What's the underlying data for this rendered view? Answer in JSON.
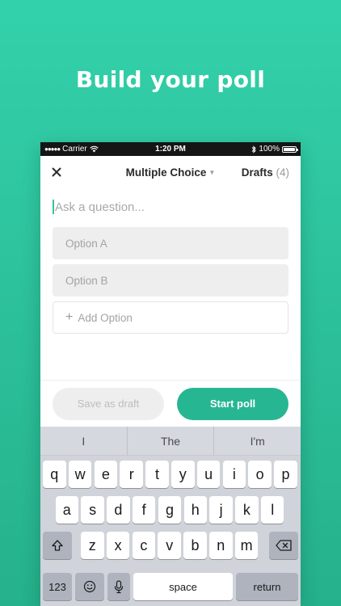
{
  "headline": "Build your poll",
  "status_bar": {
    "carrier": "Carrier",
    "time": "1:20 PM",
    "battery": "100%",
    "battery_level": 1.0
  },
  "nav": {
    "close_icon": "close-icon",
    "poll_type": "Multiple Choice",
    "drafts_label": "Drafts",
    "drafts_count": "(4)"
  },
  "question": {
    "placeholder": "Ask a question..."
  },
  "options": [
    {
      "placeholder": "Option A"
    },
    {
      "placeholder": "Option B"
    }
  ],
  "add_option_label": "Add Option",
  "buttons": {
    "save_draft": "Save as draft",
    "start_poll": "Start poll"
  },
  "keyboard": {
    "suggestions": [
      "I",
      "The",
      "I'm"
    ],
    "row1": [
      "q",
      "w",
      "e",
      "r",
      "t",
      "y",
      "u",
      "i",
      "o",
      "p"
    ],
    "row2": [
      "a",
      "s",
      "d",
      "f",
      "g",
      "h",
      "j",
      "k",
      "l"
    ],
    "row3": [
      "z",
      "x",
      "c",
      "v",
      "b",
      "n",
      "m"
    ],
    "numbers_label": "123",
    "space_label": "space",
    "return_label": "return"
  },
  "colors": {
    "background_top": "#33d1ab",
    "background_bottom": "#25b18b",
    "accent": "#27b692"
  }
}
